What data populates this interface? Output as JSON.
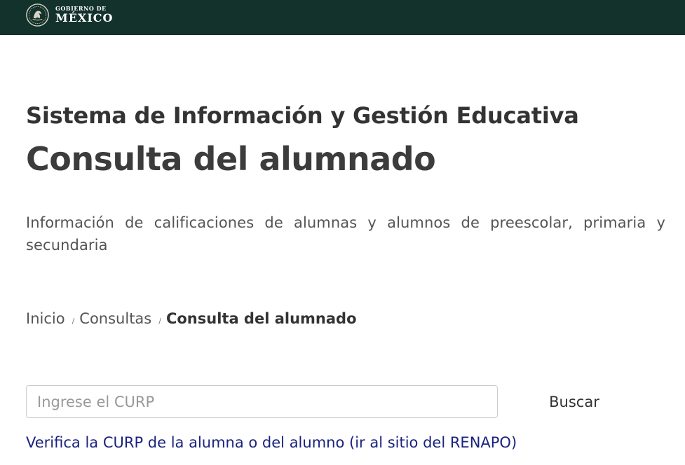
{
  "header": {
    "logo_line1": "GOBIERNO DE",
    "logo_line2": "MÉXICO",
    "bar_color": "#13322b",
    "emblem_icon": "mexico-coat-of-arms-icon"
  },
  "page": {
    "subtitle": "Sistema de Información y Gestión Educativa",
    "title": "Consulta del alumnado",
    "description": "Información de calificaciones de alumnas y alumnos de preescolar, primaria y secundaria"
  },
  "breadcrumb": {
    "items": [
      {
        "label": "Inicio"
      },
      {
        "label": "Consultas"
      },
      {
        "label": "Consulta del alumnado"
      }
    ],
    "separator": "/"
  },
  "search": {
    "placeholder": "Ingrese el CURP",
    "value": "",
    "button_label": "Buscar"
  },
  "links": {
    "verify_curp": "Verifica la CURP de la alumna o del alumno (ir al sitio del RENAPO)",
    "link_color": "#1a237e"
  }
}
